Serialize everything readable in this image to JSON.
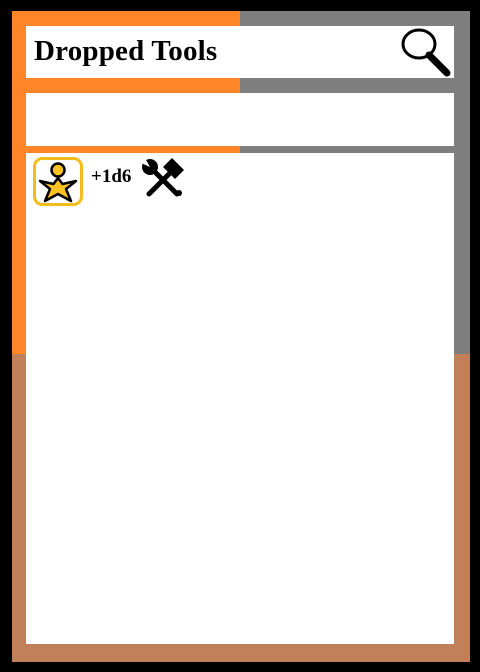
{
  "card": {
    "title": "Dropped Tools",
    "colors": {
      "border": "#000000",
      "frame_orange": "#FF8529",
      "frame_gray": "#7F7F7F",
      "frame_brown": "#BF805A",
      "panel": "#FFFFFF",
      "icon_frame": "#F2BC1A",
      "icon_fill": "#FFC31F"
    },
    "type_line": "",
    "ability": {
      "icon": "star-person-icon",
      "bonus": "+1d6",
      "tag_icon": "wrench-hammer-icon"
    },
    "search_icon": "magnifier-icon"
  }
}
